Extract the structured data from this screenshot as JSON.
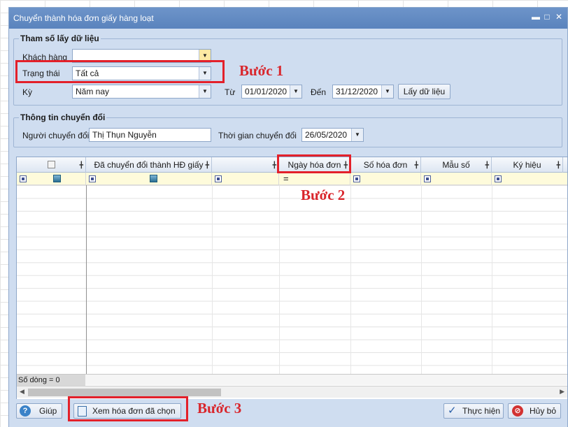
{
  "window": {
    "title": "Chuyển thành hóa đơn giấy hàng loạt",
    "min_icon": "minimize-icon",
    "max_icon": "maximize-icon",
    "close_icon": "close-icon"
  },
  "params": {
    "group_title": "Tham số lấy dữ liệu",
    "customer_label": "Khách hàng",
    "customer_value": "",
    "status_label": "Trạng thái",
    "status_value": "Tất cả",
    "period_label": "Kỳ",
    "period_value": "Năm nay",
    "from_label": "Từ",
    "from_value": "01/01/2020",
    "to_label": "Đến",
    "to_value": "31/12/2020",
    "fetch_button": "Lấy dữ liệu"
  },
  "convert_info": {
    "group_title": "Thông tin chuyển đổi",
    "converter_label": "Người chuyển đổi",
    "converter_value": "Thị Thụn Nguyễn",
    "time_label": "Thời gian chuyển đổi",
    "time_value": "26/05/2020"
  },
  "grid": {
    "columns": [
      "",
      "Đã chuyển đổi thành HĐ giấy",
      "",
      "Ngày hóa đơn",
      "Số hóa đơn",
      "Mẫu số",
      "Ký hiệu"
    ],
    "filter_equals": "=",
    "row_count": "Số dòng = 0"
  },
  "footer": {
    "help_button": "Giúp",
    "view_button": "Xem hóa đơn đã chọn",
    "execute_button": "Thực hiện",
    "cancel_button": "Hủy bỏ"
  },
  "annotations": {
    "step1": "Bước 1",
    "step2": "Bước 2",
    "step3": "Bước 3"
  },
  "colors": {
    "accent": "#e3202a",
    "title_bar": "#5a83bd",
    "dialog_bg": "#cfddf0",
    "filter_row": "#fefbdb"
  }
}
